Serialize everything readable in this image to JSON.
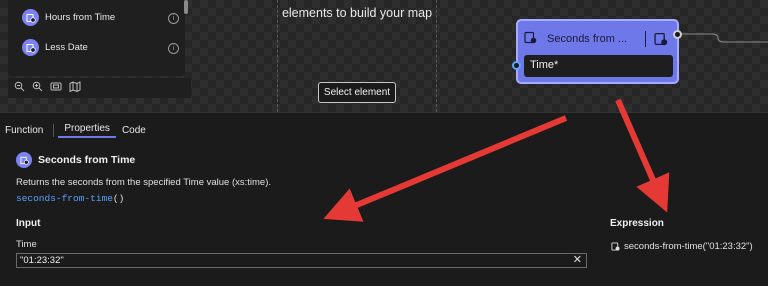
{
  "toolbox": {
    "items": [
      {
        "label": "Hours from Time",
        "icon": "clock-function-icon"
      },
      {
        "label": "Less Date",
        "icon": "clock-function-icon"
      }
    ],
    "info_glyph": "i",
    "zoom_controls": [
      "zoom-out-icon",
      "zoom-in-icon",
      "fit-view-icon",
      "map-icon"
    ]
  },
  "canvas": {
    "empty_message": "elements to build your map",
    "select_button": "Select element"
  },
  "node": {
    "title": "Seconds from ...",
    "input_label": "Time*"
  },
  "properties": {
    "tabs": [
      "Function",
      "Properties",
      "Code"
    ],
    "active_tab": "Properties",
    "function_title": "Seconds from Time",
    "description": "Returns the seconds from the specified Time value (xs:time).",
    "signature_name": "seconds-from-time",
    "signature_suffix": "()",
    "input_heading": "Input",
    "input_field_label": "Time",
    "input_value": "\"01:23:32\"",
    "clear_glyph": "✕",
    "expression_heading": "Expression",
    "expression_value": "seconds-from-time(\"01:23:32\")"
  },
  "colors": {
    "accent": "#6f78e8",
    "arrow": "#e53935",
    "link": "#5aa0ff"
  }
}
